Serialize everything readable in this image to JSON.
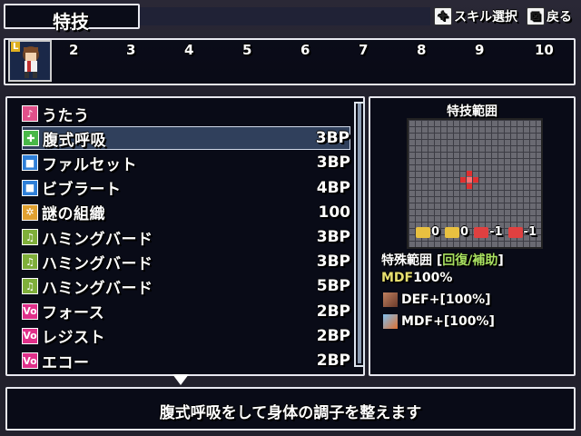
{
  "header": {
    "title": "特技",
    "hints": [
      {
        "key": "✚",
        "label": "スキル選択"
      },
      {
        "key": "⊠",
        "label": "戻る"
      }
    ]
  },
  "party": {
    "slot1_level_badge": "L",
    "slots": [
      "2",
      "3",
      "4",
      "5",
      "6",
      "7",
      "8",
      "9",
      "10"
    ]
  },
  "skills": [
    {
      "name": "うたう",
      "cost": "",
      "icon": "sing-icon",
      "icon_color": "#e0508a",
      "icon_char": "♪",
      "selected": false
    },
    {
      "name": "腹式呼吸",
      "cost": "3BP",
      "icon": "plus-heal-icon",
      "icon_color": "#48b848",
      "icon_char": "✚",
      "selected": true
    },
    {
      "name": "ファルセット",
      "cost": "3BP",
      "icon": "square-blue-icon",
      "icon_color": "#2f7fd8",
      "icon_char": "■",
      "selected": false
    },
    {
      "name": "ビブラート",
      "cost": "4BP",
      "icon": "square-blue-icon",
      "icon_color": "#2f7fd8",
      "icon_char": "■",
      "selected": false
    },
    {
      "name": "謎の組織",
      "cost": "100",
      "icon": "mystery-icon",
      "icon_color": "#e0a030",
      "icon_char": "✲",
      "selected": false
    },
    {
      "name": "ハミングバード",
      "cost": "3BP",
      "icon": "note-icon",
      "icon_color": "#7fae3a",
      "icon_char": "♫",
      "selected": false
    },
    {
      "name": "ハミングバード",
      "cost": "3BP",
      "icon": "note-plus-icon",
      "icon_color": "#7fae3a",
      "icon_char": "♫",
      "selected": false
    },
    {
      "name": "ハミングバード",
      "cost": "5BP",
      "icon": "note-plus2-icon",
      "icon_color": "#7fae3a",
      "icon_char": "♫",
      "selected": false
    },
    {
      "name": "フォース",
      "cost": "2BP",
      "icon": "vo-icon",
      "icon_color": "#e0308a",
      "icon_char": "Vo",
      "selected": false
    },
    {
      "name": "レジスト",
      "cost": "2BP",
      "icon": "vo-icon",
      "icon_color": "#e0308a",
      "icon_char": "Vo",
      "selected": false
    },
    {
      "name": "エコー",
      "cost": "2BP",
      "icon": "vo-icon",
      "icon_color": "#e0308a",
      "icon_char": "Vo",
      "selected": false
    }
  ],
  "range": {
    "title": "特技範囲",
    "stats": [
      {
        "value": "0",
        "color": "#e8c040"
      },
      {
        "value": "0",
        "color": "#e8c040"
      },
      {
        "value": "-1",
        "color": "#e04040"
      },
      {
        "value": "-1",
        "color": "#e04040"
      }
    ],
    "special_label": "特殊範囲 [",
    "special_type": "回復/補助",
    "special_end": "]",
    "mdf_label": "MDF",
    "mdf_value": "100%",
    "buffs": [
      {
        "label": "DEF+[100%]",
        "icon": "def-up-icon"
      },
      {
        "label": "MDF+[100%]",
        "icon": "mdf-up-icon"
      }
    ]
  },
  "help": {
    "text": "腹式呼吸をして身体の調子を整えます"
  }
}
